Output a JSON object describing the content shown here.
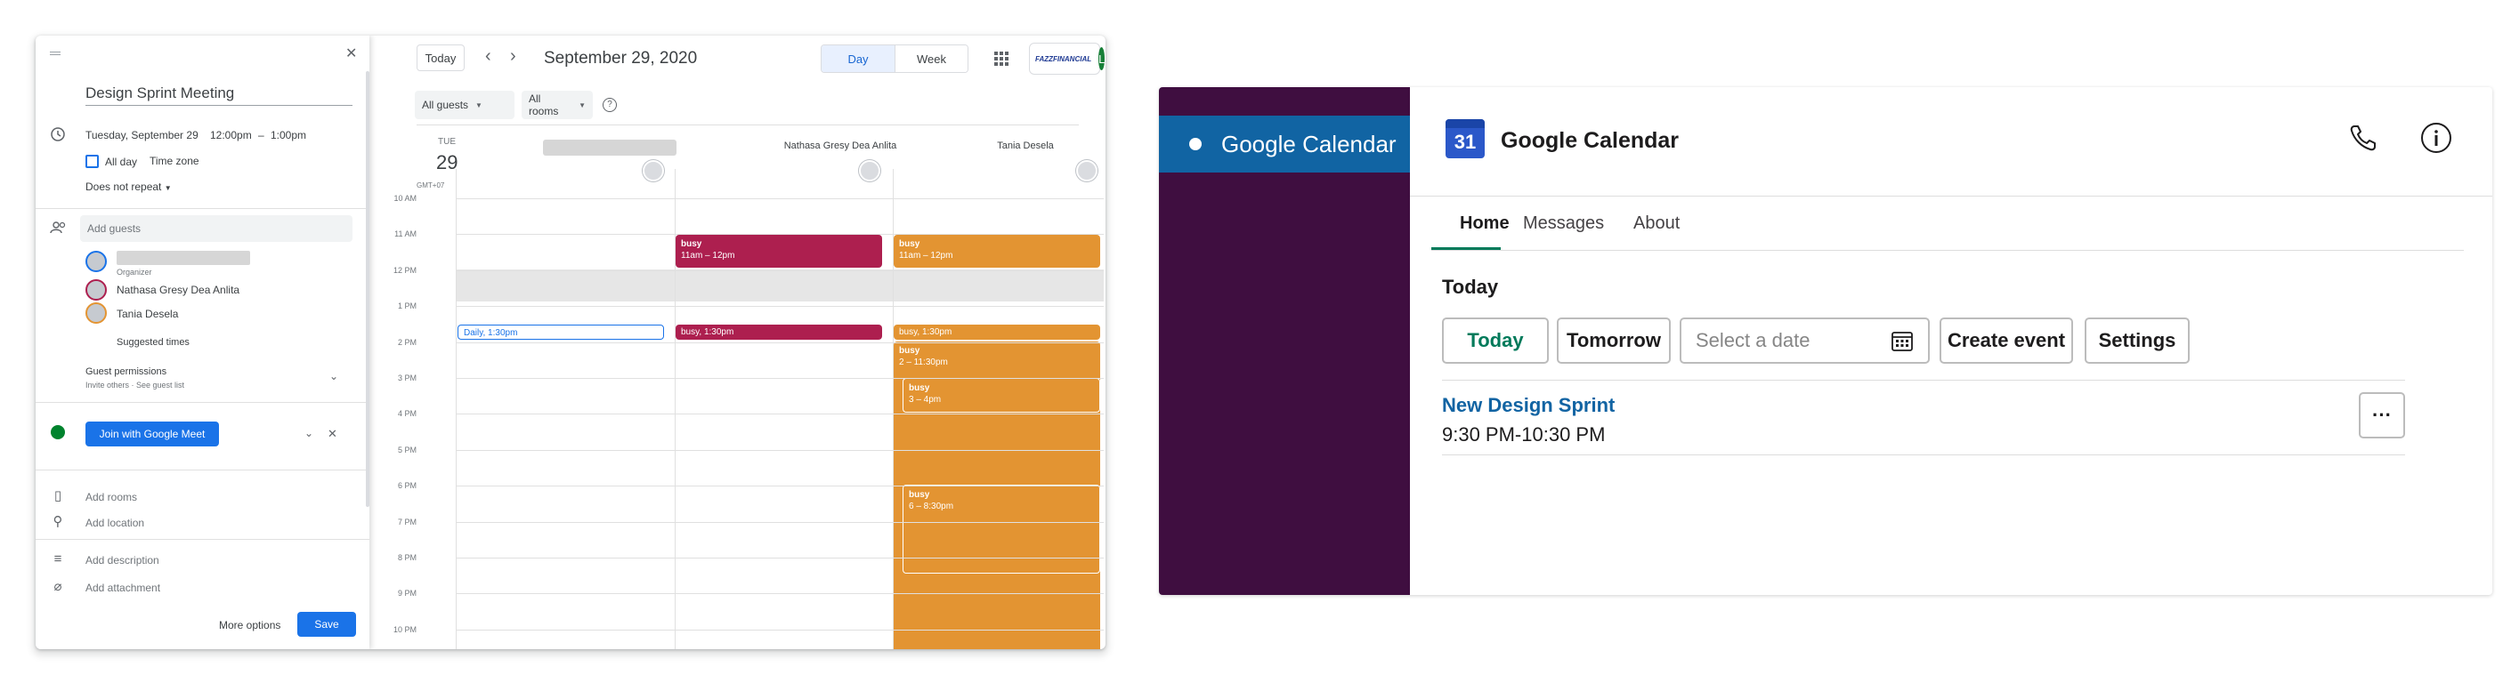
{
  "gcal": {
    "toolbar": {
      "today_label": "Today",
      "date_title": "September 29, 2020",
      "view_day": "Day",
      "view_week": "Week",
      "brand_name": "FAZZFINANCIAL",
      "user_initial": "L"
    },
    "filters": {
      "guests": "All guests",
      "rooms": "All rooms"
    },
    "day": {
      "dow": "TUE",
      "num": "29",
      "tz": "GMT+07"
    },
    "guest_columns": [
      "Nathasa Gresy Dea Anlita",
      "Tania Desela"
    ],
    "hours": [
      "10 AM",
      "11 AM",
      "12 PM",
      "1 PM",
      "2 PM",
      "3 PM",
      "4 PM",
      "5 PM",
      "6 PM",
      "7 PM",
      "8 PM",
      "9 PM",
      "10 PM"
    ],
    "events": {
      "col2_busy1_title": "busy",
      "col2_busy1_time": "11am – 12pm",
      "col3_busy1_title": "busy",
      "col3_busy1_time": "11am – 12pm",
      "col1_daily": "Daily, 1:30pm",
      "col2_busy2": "busy, 1:30pm",
      "col3_busy2": "busy, 1:30pm",
      "col3_long_title": "busy",
      "col3_long_time": "2 – 11:30pm",
      "col3_inner1_title": "busy",
      "col3_inner1_time": "3 – 4pm",
      "col3_inner2_title": "busy",
      "col3_inner2_time": "6 – 8:30pm"
    },
    "panel": {
      "title": "Design Sprint Meeting",
      "date": "Tuesday, September 29",
      "time_start": "12:00pm",
      "time_sep": "–",
      "time_end": "1:00pm",
      "all_day": "All day",
      "time_zone": "Time zone",
      "repeat": "Does not repeat",
      "add_guests_placeholder": "Add guests",
      "organizer_label": "Organizer",
      "guests": [
        "Nathasa Gresy Dea Anlita",
        "Tania Desela"
      ],
      "suggested_times": "Suggested times",
      "guest_permissions": "Guest permissions",
      "permissions_sub": "Invite others · See guest list",
      "meet_button": "Join with Google Meet",
      "add_rooms": "Add rooms",
      "add_location": "Add location",
      "add_description": "Add description",
      "add_attachment": "Add attachment",
      "more_options": "More options",
      "save": "Save"
    },
    "colors": {
      "crimson": "#ad1f4f",
      "orange": "#e39432",
      "blue": "#1a73e8"
    }
  },
  "slack": {
    "sidebar_item": "Google Calendar",
    "app_title": "Google Calendar",
    "app_icon_number": "31",
    "tabs": [
      "Home",
      "Messages",
      "About"
    ],
    "section_title": "Today",
    "buttons": {
      "today": "Today",
      "tomorrow": "Tomorrow",
      "create": "Create event",
      "settings": "Settings"
    },
    "date_placeholder": "Select a date",
    "event_title": "New Design Sprint",
    "event_time": "9:30 PM-10:30 PM",
    "colors": {
      "sidebar": "#3f0e40",
      "selected": "#1164a3",
      "link": "#1264a3",
      "green": "#007a5a"
    }
  }
}
